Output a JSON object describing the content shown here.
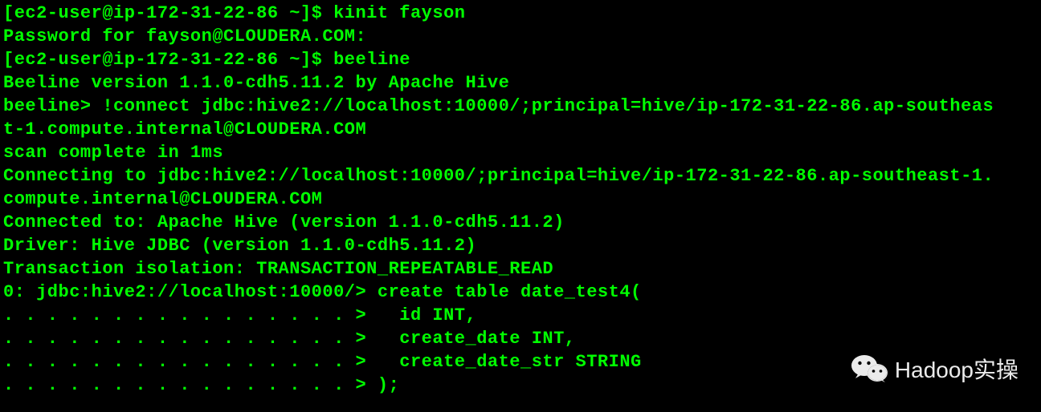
{
  "terminal": {
    "lines": [
      "[ec2-user@ip-172-31-22-86 ~]$ kinit fayson",
      "Password for fayson@CLOUDERA.COM:",
      "[ec2-user@ip-172-31-22-86 ~]$ beeline",
      "Beeline version 1.1.0-cdh5.11.2 by Apache Hive",
      "beeline> !connect jdbc:hive2://localhost:10000/;principal=hive/ip-172-31-22-86.ap-southeas",
      "t-1.compute.internal@CLOUDERA.COM",
      "scan complete in 1ms",
      "Connecting to jdbc:hive2://localhost:10000/;principal=hive/ip-172-31-22-86.ap-southeast-1.",
      "compute.internal@CLOUDERA.COM",
      "Connected to: Apache Hive (version 1.1.0-cdh5.11.2)",
      "Driver: Hive JDBC (version 1.1.0-cdh5.11.2)",
      "Transaction isolation: TRANSACTION_REPEATABLE_READ",
      "0: jdbc:hive2://localhost:10000/> create table date_test4(",
      ". . . . . . . . . . . . . . . . >   id INT,",
      ". . . . . . . . . . . . . . . . >   create_date INT,",
      ". . . . . . . . . . . . . . . . >   create_date_str STRING",
      ". . . . . . . . . . . . . . . . > );"
    ]
  },
  "watermark": {
    "text": "Hadoop实操"
  }
}
